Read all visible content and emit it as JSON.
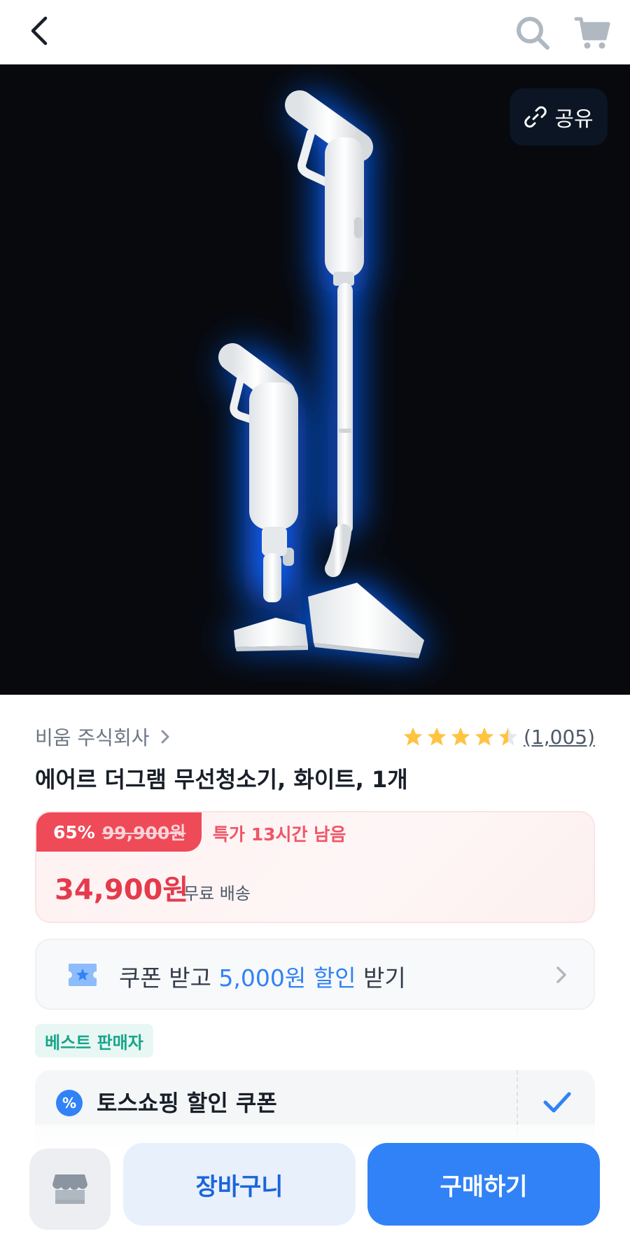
{
  "header": {
    "back_icon": "chevron-left-icon",
    "search_icon": "search-icon",
    "cart_icon": "cart-icon"
  },
  "hero": {
    "share_label": "공유",
    "share_icon": "link-icon",
    "product_image": "white cordless stick vacuum with blue glow"
  },
  "product": {
    "seller": "비움 주식회사",
    "rating": 4.5,
    "review_count": "(1,005)",
    "title": "에어르 더그램 무선청소기, 화이트, 1개"
  },
  "price": {
    "discount": "65%",
    "original": "99,900원",
    "deal_timer": "특가 13시간 남음",
    "sale_price": "34,900원",
    "shipping": "무료 배송"
  },
  "coupon": {
    "prefix": "쿠폰 받고 ",
    "amount": "5,000원 할인",
    "suffix": " 받기"
  },
  "badge": {
    "label": "베스트 판매자"
  },
  "discount_coupon": {
    "label": "토스쇼핑 할인 쿠폰",
    "checked": true
  },
  "bottom": {
    "store_icon": "store-icon",
    "cart_label": "장바구니",
    "buy_label": "구매하기"
  },
  "colors": {
    "accent": "#3182f6",
    "sale": "#e43b4d",
    "badge_green": "#18a58a"
  }
}
